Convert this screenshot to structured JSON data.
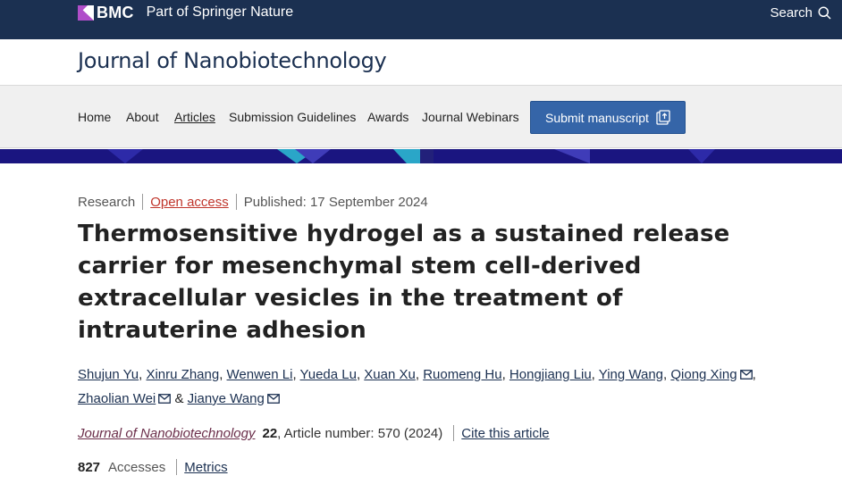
{
  "topbar": {
    "brand": "BMC",
    "part_of": "Part of Springer Nature",
    "search_label": "Search",
    "background": "#1b3051",
    "brand_accent": "#b04ec9"
  },
  "journal": {
    "title": "Journal of Nanobiotechnology"
  },
  "nav": {
    "items": [
      "Home",
      "About",
      "Articles",
      "Submission Guidelines",
      "Awards",
      "Journal Webinars"
    ],
    "active": "Articles",
    "submit_label": "Submit manuscript"
  },
  "article": {
    "type": "Research",
    "access": "Open access",
    "published": "Published: 17 September 2024",
    "title": "Thermosensitive hydrogel as a sustained release carrier for mesenchymal stem cell-derived extracellular vesicles in the treatment of intrauterine adhesion",
    "authors": [
      "Shujun Yu",
      "Xinru Zhang",
      "Wenwen Li",
      "Yueda Lu",
      "Xuan Xu",
      "Ruomeng Hu",
      "Hongjiang Liu",
      "Ying Wang",
      "Qiong Xing",
      "Zhaolian Wei",
      "Jianye Wang"
    ],
    "corresponding_icon": "envelope-icon",
    "and": "&",
    "comma": ",",
    "journal_name": "Journal of Nanobiotechnology",
    "volume": "22",
    "article_number": ", Article number: 570 (2024)",
    "cite_label": "Cite this article",
    "accesses_count": "827",
    "accesses_label": "Accesses",
    "metrics_label": "Metrics"
  }
}
